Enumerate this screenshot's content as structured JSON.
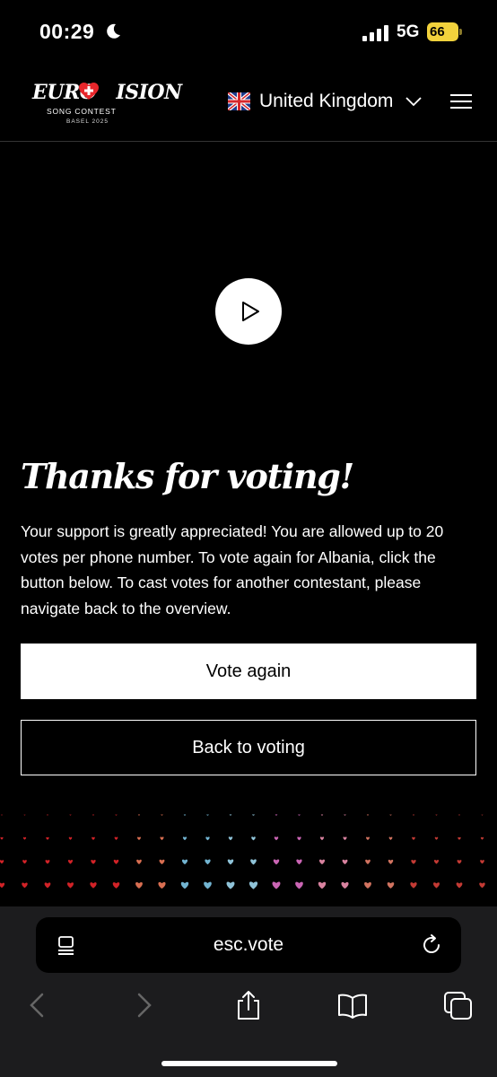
{
  "status_bar": {
    "time": "00:29",
    "network": "5G",
    "battery": "66"
  },
  "header": {
    "logo": {
      "main_before": "EURO",
      "main_after": "ISION",
      "sub": "SONG CONTEST",
      "sub2": "BASEL 2025"
    },
    "country": "United Kingdom"
  },
  "video": {
    "play_icon": "play-icon"
  },
  "content": {
    "title": "Thanks for voting!",
    "body": "Your support is greatly appreciated! You are allowed up to 20 votes per phone number. To vote again for Albania, click the button below. To cast votes for another contestant, please navigate back to the overview.",
    "vote_again_label": "Vote again",
    "back_label": "Back to voting"
  },
  "browser": {
    "url": "esc.vote"
  },
  "colors": {
    "background": "#000000",
    "accent_red": "#e8262b",
    "battery": "#f2d23c",
    "toolbar": "#1c1c1e"
  }
}
